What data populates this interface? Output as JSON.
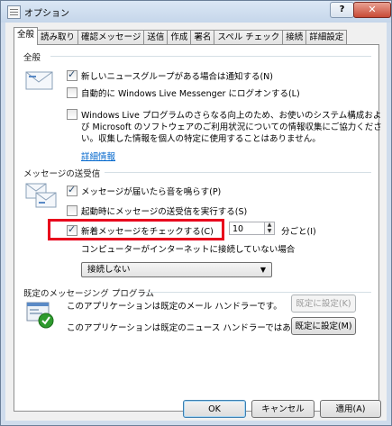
{
  "window": {
    "title": "オプション",
    "help_label": "?",
    "close_label": "✕"
  },
  "tabs": [
    {
      "label": "全般",
      "active": true
    },
    {
      "label": "読み取り"
    },
    {
      "label": "確認メッセージ"
    },
    {
      "label": "送信"
    },
    {
      "label": "作成"
    },
    {
      "label": "署名"
    },
    {
      "label": "スペル チェック"
    },
    {
      "label": "接続"
    },
    {
      "label": "詳細設定"
    }
  ],
  "general": {
    "group_label": "全般",
    "notify_newsgroups": {
      "label": "新しいニュースグループがある場合は通知する(N)",
      "checked": true
    },
    "auto_logon": {
      "label": "自動的に Windows Live Messenger にログオンする(L)",
      "checked": false
    },
    "improvement": {
      "label_line1": "Windows Live プログラムのさらなる向上のため、お使いのシステム構成およ",
      "label_line2": "び Microsoft のソフトウェアのご利用状況についての情報収集にご協力くださ",
      "label_line3": "い。収集した情報を個人の特定に使用することはありません。",
      "checked": false
    },
    "details_link": "詳細情報"
  },
  "send_receive": {
    "group_label": "メッセージの送受信",
    "play_sound": {
      "label": "メッセージが届いたら音を鳴らす(P)",
      "checked": true
    },
    "send_receive_on_start": {
      "label": "起動時にメッセージの送受信を実行する(S)",
      "checked": false
    },
    "check_every": {
      "label": "新着メッセージをチェックする(C)",
      "checked": true,
      "value": "10",
      "unit_label": "分ごと(I)"
    },
    "offline_label": "コンピューターがインターネットに接続していない場合",
    "offline_select": "接続しない",
    "dropdown_arrow": "▼"
  },
  "default_program": {
    "group_label": "既定のメッセージング プログラム",
    "mail_text": "このアプリケーションは既定のメール ハンドラーです。",
    "mail_button": "既定に設定(K)",
    "news_text": "このアプリケーションは既定のニュース ハンドラーではありません。",
    "news_button": "既定に設定(M)"
  },
  "footer": {
    "ok": "OK",
    "cancel": "キャンセル",
    "apply": "適用(A)"
  },
  "colors": {
    "highlight": "#e8001c",
    "link": "#0066cc"
  }
}
